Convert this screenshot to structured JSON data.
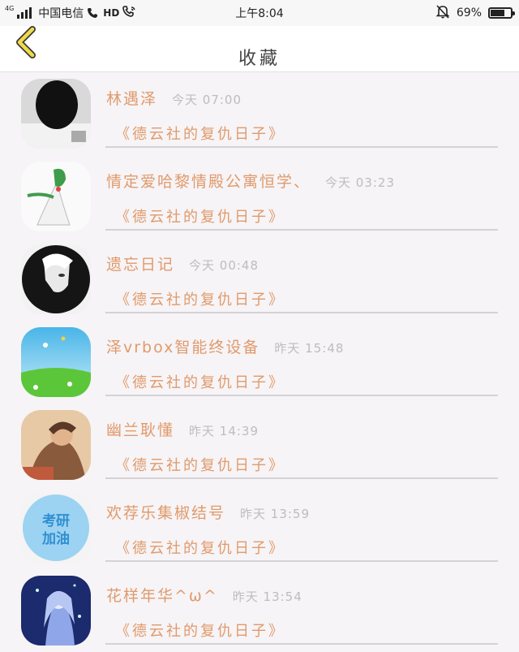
{
  "status_bar": {
    "network": "4G",
    "carrier": "中国电信",
    "hd": "HD",
    "time": "上午8:04",
    "battery_text": "69%",
    "battery_level": 0.69
  },
  "header": {
    "title": "收藏",
    "back_icon": "chevron-left-icon"
  },
  "favorites": [
    {
      "name": "林遇泽",
      "time": "今天 07:00",
      "work": "《德云社的复仇日子》"
    },
    {
      "name": "情定爱哈黎情殿公寓恒学、",
      "time": "今天 03:23",
      "work": "《德云社的复仇日子》"
    },
    {
      "name": "遗忘日记",
      "time": "今天 00:48",
      "work": "《德云社的复仇日子》"
    },
    {
      "name": "泽vrbox智能终设备",
      "time": "昨天 15:48",
      "work": "《德云社的复仇日子》"
    },
    {
      "name": "幽兰耿懂",
      "time": "昨天 14:39",
      "work": "《德云社的复仇日子》"
    },
    {
      "name": "欢荐乐集椒结号",
      "time": "昨天 13:59",
      "work": "《德云社的复仇日子》"
    },
    {
      "name": "花样年华^ω^",
      "time": "昨天 13:54",
      "work": "《德云社的复仇日子》"
    }
  ],
  "avatar_badge_text": [
    "考研",
    "加油"
  ],
  "colors": {
    "accent": "#e09a6c",
    "back_arrow": "#f0da4a",
    "time_gray": "#bdbdbd",
    "divider": "#d4d2d4",
    "background": "#f6f4f6"
  }
}
